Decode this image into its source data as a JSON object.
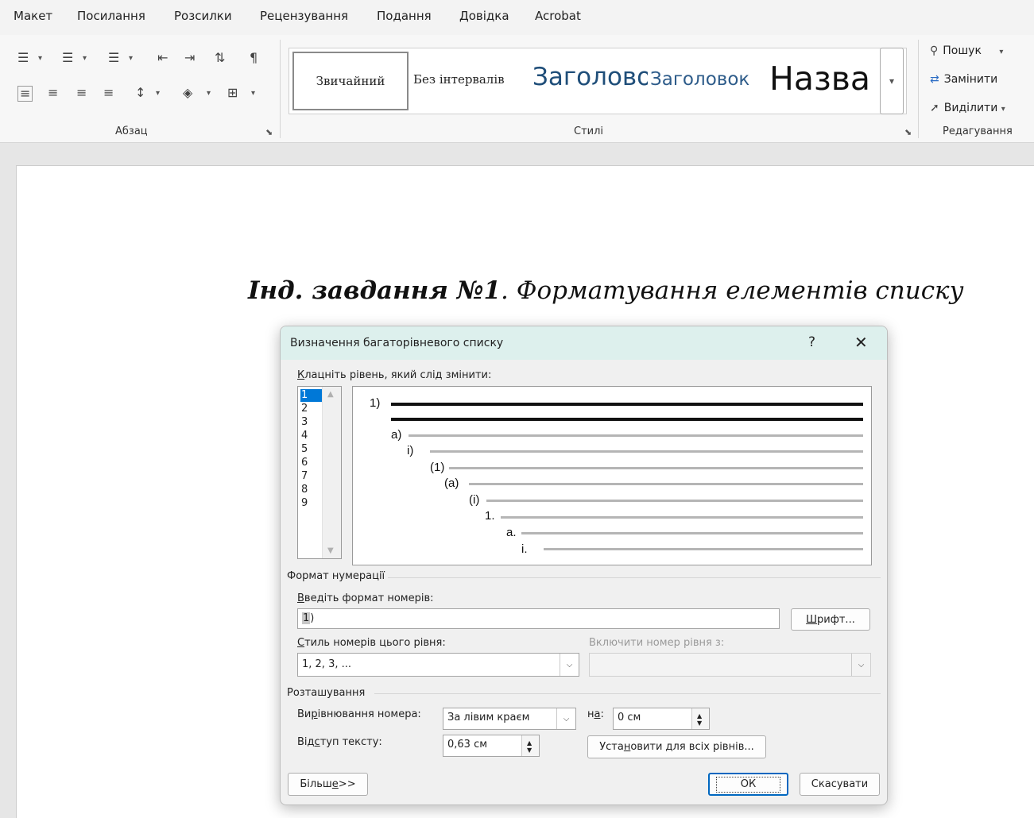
{
  "menu": [
    "Макет",
    "Посилання",
    "Розсилки",
    "Рецензування",
    "Подання",
    "Довідка",
    "Acrobat"
  ],
  "ribbon": {
    "groups": {
      "paragraph": "Абзац",
      "styles": "Стилі",
      "editing": "Редагування"
    },
    "styles": [
      {
        "label": "Звичайний"
      },
      {
        "label": "Без інтервалів"
      },
      {
        "label": "Заголово"
      },
      {
        "label": "Заголовок"
      },
      {
        "label": "Назва"
      }
    ],
    "editing": {
      "find": "Пошук",
      "replace": "Замінити",
      "select": "Виділити"
    }
  },
  "document": {
    "title_bold": "Інд. завдання №1",
    "title_rest": ". Форматування елементів списку"
  },
  "dialog": {
    "title": "Визначення багаторівневого списку",
    "help": "?",
    "close": "✕",
    "level_prompt_pre": "",
    "level_prompt_acc": "К",
    "level_prompt_post": "лацніть рівень, який слід змінити:",
    "levels": [
      "1",
      "2",
      "3",
      "4",
      "5",
      "6",
      "7",
      "8",
      "9"
    ],
    "selected_level": "1",
    "preview_numbers": [
      "1)",
      "a)",
      "i)",
      "(1)",
      "(a)",
      "(i)",
      "1.",
      "a.",
      "i."
    ],
    "number_format_section": "Формат нумерації",
    "enter_format_acc": "В",
    "enter_format_post": "ведіть формат номерів:",
    "format_value_num": "1",
    "format_value_rest": ")",
    "font_button_acc": "Ш",
    "font_button_post": "рифт...",
    "number_style_acc": "С",
    "number_style_post": "тиль номерів цього рівня:",
    "number_style_value": "1, 2, 3, ...",
    "include_level_label": "Включити номер рівня з:",
    "include_level_value": "",
    "position_section": "Розташування",
    "alignment_pre": "Ви",
    "alignment_acc": "р",
    "alignment_post": "івнювання номера:",
    "alignment_value": "За лівим краєм",
    "at_pre": "н",
    "at_acc": "а",
    "at_post": ":",
    "at_value": "0 см",
    "indent_pre": "Від",
    "indent_acc": "с",
    "indent_post": "туп тексту:",
    "indent_value": "0,63 см",
    "set_all_pre": "Уста",
    "set_all_acc": "н",
    "set_all_post": "овити для всіх рівнів...",
    "more_pre": "Більш",
    "more_acc": "е",
    "more_post": " >>",
    "ok": "ОК",
    "cancel": "Скасувати"
  }
}
